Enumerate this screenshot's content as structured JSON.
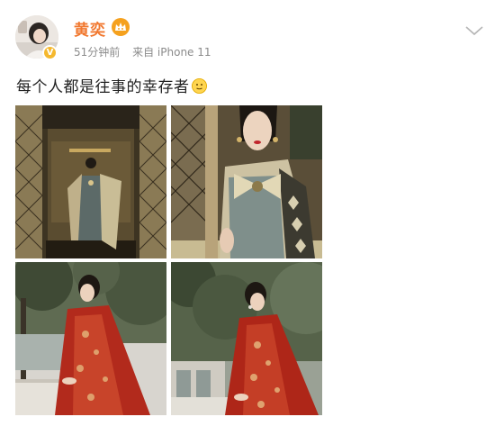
{
  "post": {
    "author_name": "黄奕",
    "time_ago": "51分钟前",
    "source": "来自 iPhone 11",
    "text": "每个人都是往事的幸存者",
    "verified_mark": "V"
  },
  "icons": {
    "vip_badge": "crown-badge-icon",
    "verified": "verified-badge-icon",
    "more": "chevron-down-icon",
    "emoji": "smile-emoji-icon"
  },
  "colors": {
    "name": "#f1782f",
    "meta": "#8b8b8b",
    "verified": "#f5b82e"
  },
  "images": [
    {
      "alt": "elevator-gown-photo"
    },
    {
      "alt": "closeup-gown-photo"
    },
    {
      "alt": "red-cape-balcony-photo"
    },
    {
      "alt": "red-cape-tree-photo"
    }
  ]
}
